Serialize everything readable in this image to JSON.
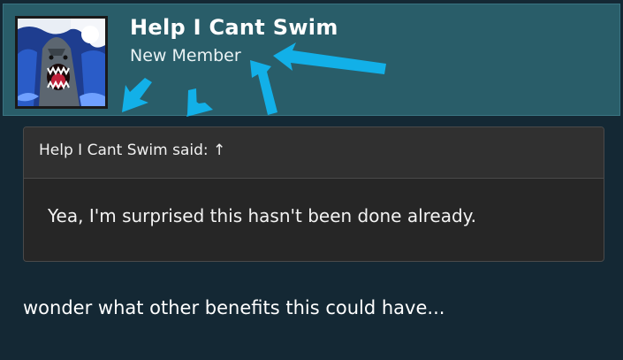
{
  "profile": {
    "username": "Help I Cant Swim",
    "user_title": "New Member",
    "avatar_icon": "shark-avatar-icon"
  },
  "quote": {
    "attribution": "Help I Cant Swim said: ↑",
    "text": "Yea, I'm surprised this hasn't been done already."
  },
  "post": {
    "text": "wonder what other benefits this could have..."
  },
  "colors": {
    "header_bg": "#295d69",
    "page_bg": "#142834",
    "arrow": "#12b0e8"
  }
}
